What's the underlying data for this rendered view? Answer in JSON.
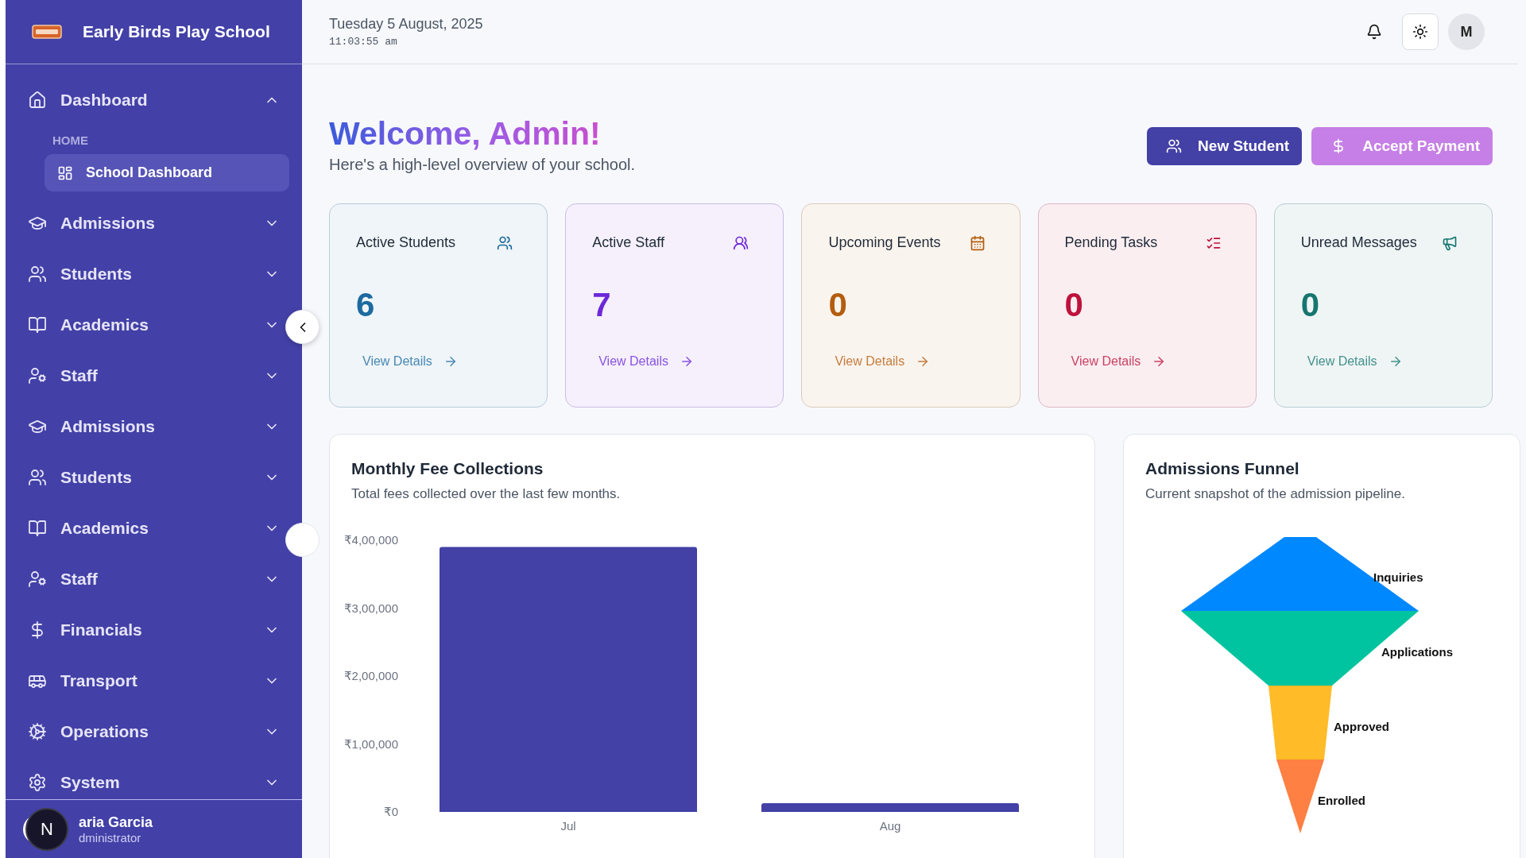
{
  "sidebar": {
    "brand": "Early Birds Play School",
    "nav": [
      {
        "label": "Dashboard",
        "expanded": true,
        "section": "HOME",
        "children": [
          {
            "label": "School Dashboard",
            "selected": true
          }
        ]
      },
      {
        "label": "Admissions",
        "expanded": false
      },
      {
        "label": "Students",
        "expanded": false
      },
      {
        "label": "Academics",
        "expanded": false
      },
      {
        "label": "Staff",
        "expanded": false
      },
      {
        "label": "Admissions",
        "expanded": false
      },
      {
        "label": "Students",
        "expanded": false
      },
      {
        "label": "Academics",
        "expanded": false
      },
      {
        "label": "Staff",
        "expanded": false
      },
      {
        "label": "Financials",
        "expanded": false
      },
      {
        "label": "Transport",
        "expanded": false
      },
      {
        "label": "Operations",
        "expanded": false
      },
      {
        "label": "System",
        "expanded": false
      }
    ],
    "user": {
      "name": "aria Garcia",
      "role": "dministrator",
      "badge": "N"
    }
  },
  "header": {
    "date": "Tuesday 5 August, 2025",
    "time": "11:03:55 am",
    "avatar": "M"
  },
  "welcome": {
    "title": "Welcome, Admin!",
    "subtitle": "Here's a high-level overview of your school."
  },
  "actions": [
    {
      "label": "New Student",
      "kind": "primary"
    },
    {
      "label": "Accept Payment",
      "kind": "secondary"
    }
  ],
  "stats": [
    {
      "title": "Active Students",
      "value": "6",
      "link": "View Details",
      "color": "#1c6aa0"
    },
    {
      "title": "Active Staff",
      "value": "7",
      "link": "View Details",
      "color": "#6d28d9"
    },
    {
      "title": "Upcoming Events",
      "value": "0",
      "link": "View Details",
      "color": "#b45d0f"
    },
    {
      "title": "Pending Tasks",
      "value": "0",
      "link": "View Details",
      "color": "#be123c"
    },
    {
      "title": "Unread Messages",
      "value": "0",
      "link": "View Details",
      "color": "#15766f"
    }
  ],
  "fee_chart": {
    "title": "Monthly Fee Collections",
    "subtitle": "Total fees collected over the last few months.",
    "chart_data": {
      "type": "bar",
      "categories": [
        "Jul",
        "Aug"
      ],
      "values": [
        390000,
        13000
      ],
      "ylim": [
        0,
        400000
      ],
      "yticks": [
        {
          "value": 0,
          "label": "₹0"
        },
        {
          "value": 100000,
          "label": "₹1,00,000"
        },
        {
          "value": 200000,
          "label": "₹2,00,000"
        },
        {
          "value": 300000,
          "label": "₹3,00,000"
        },
        {
          "value": 400000,
          "label": "₹4,00,000"
        }
      ]
    }
  },
  "funnel": {
    "title": "Admissions Funnel",
    "subtitle": "Current snapshot of the admission pipeline.",
    "stages": [
      {
        "label": "Inquiries",
        "color": "#0088fe"
      },
      {
        "label": "Applications",
        "color": "#00c49f"
      },
      {
        "label": "Approved",
        "color": "#ffbb28"
      },
      {
        "label": "Enrolled",
        "color": "#ff8042"
      }
    ]
  }
}
